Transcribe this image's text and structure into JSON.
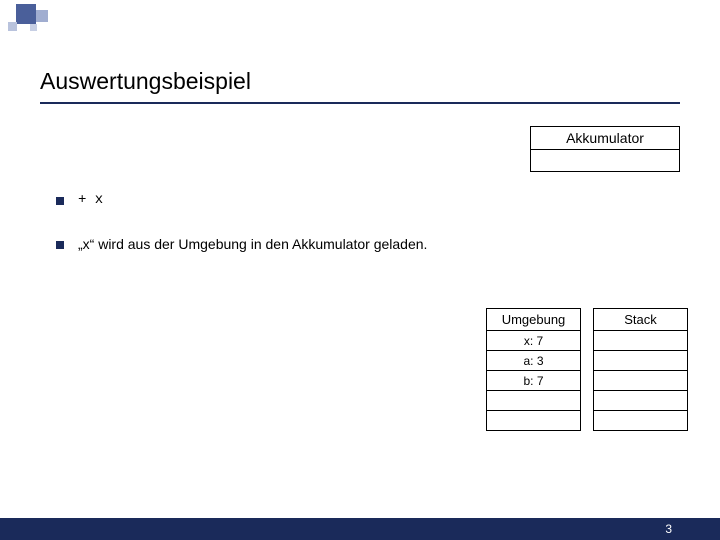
{
  "title": "Auswertungsbeispiel",
  "accumulator": {
    "label": "Akkumulator",
    "value": ""
  },
  "bullets": [
    {
      "text": "+ x",
      "mono": true
    },
    {
      "text": "„x“ wird aus der Umgebung in den Akkumulator geladen.",
      "mono": false
    }
  ],
  "umgebung": {
    "label": "Umgebung",
    "rows": [
      "x: 7",
      "a: 3",
      "b: 7",
      "",
      ""
    ]
  },
  "stack": {
    "label": "Stack",
    "rows": [
      "",
      "",
      "",
      "",
      ""
    ]
  },
  "footer": {
    "page": "3"
  }
}
